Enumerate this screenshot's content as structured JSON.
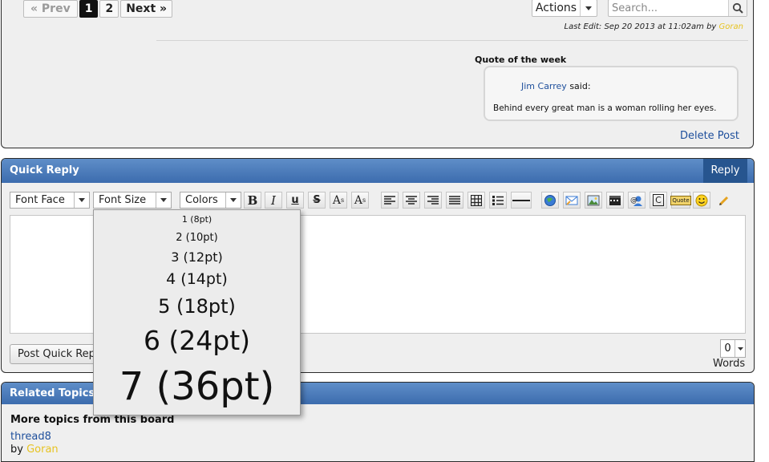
{
  "pager": {
    "prev": "« Prev",
    "pages": [
      "1",
      "2"
    ],
    "current": "1",
    "next": "Next »"
  },
  "toolbar": {
    "actions_label": "Actions",
    "search_placeholder": "Search..."
  },
  "post": {
    "last_edit_prefix": "Last Edit: Sep 20 2013 at 11:02am by",
    "last_edit_user": "Goran",
    "quote_title": "Quote of the week",
    "quote_author": "Jim Carrey",
    "quote_said": "said:",
    "quote_text": "Behind every great man is a woman rolling her eyes.",
    "delete_label": "Delete Post"
  },
  "quick_reply": {
    "title": "Quick Reply",
    "reply_tab": "Reply",
    "font_face": "Font Face",
    "font_size": "Font Size",
    "colors": "Colors",
    "buttons": {
      "bold": "B",
      "italic": "I",
      "underline": "u",
      "strike": "S",
      "sup": "A",
      "sup_s": "s",
      "sub": "A",
      "sub_s": "s",
      "copyright": "C",
      "quote": "Quote"
    },
    "post_button": "Post Quick Reply",
    "word_count": "0",
    "words_label": "Words"
  },
  "font_size_menu": [
    {
      "label": "1 (8pt)",
      "pt": 8
    },
    {
      "label": "2 (10pt)",
      "pt": 10
    },
    {
      "label": "3 (12pt)",
      "pt": 12
    },
    {
      "label": "4 (14pt)",
      "pt": 14
    },
    {
      "label": "5 (18pt)",
      "pt": 18
    },
    {
      "label": "6 (24pt)",
      "pt": 24
    },
    {
      "label": "7 (36pt)",
      "pt": 36
    }
  ],
  "related": {
    "title": "Related Topics",
    "more_label": "More topics from this board",
    "topic_link": "thread8",
    "by_label": "by",
    "by_user": "Goran"
  },
  "colors": {
    "link": "#1e4f9c",
    "username": "#e7c321",
    "header_blue": "#3c6cae",
    "reply_tab": "#27558f"
  }
}
